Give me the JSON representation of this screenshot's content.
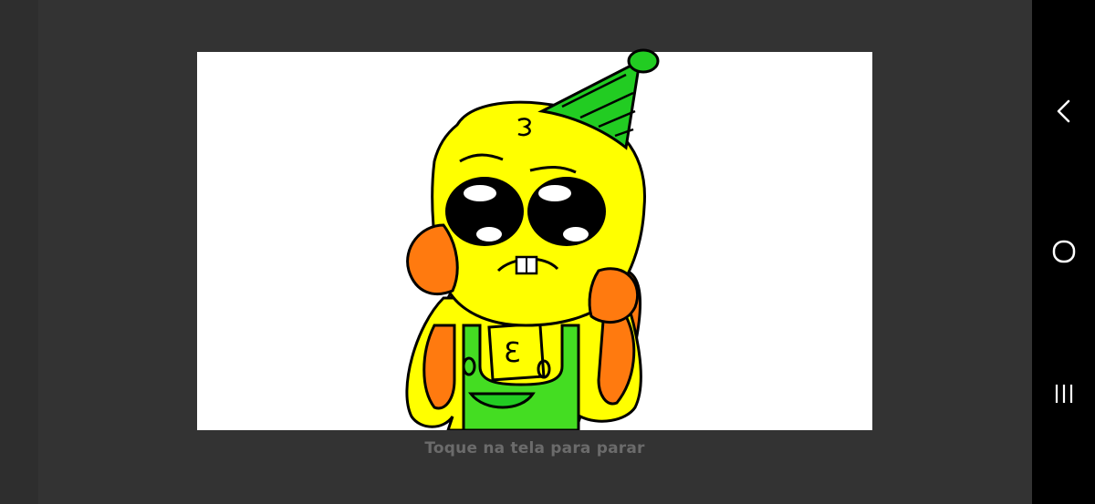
{
  "player": {
    "hint_text": "Toque na tela para parar",
    "drawing_letter": "Ɛ",
    "colors": {
      "background": "#333333",
      "canvas": "#ffffff",
      "body_yellow": "#ffff00",
      "cheek_orange": "#ff7a0f",
      "hat_green": "#22cc22",
      "shirt_green": "#44dd22",
      "outline": "#000000",
      "hint_text": "#6b6b6b"
    }
  },
  "navigation_bar": {
    "back_icon": "chevron-left-icon",
    "home_icon": "circle-home-icon",
    "recents_icon": "three-bars-icon"
  }
}
